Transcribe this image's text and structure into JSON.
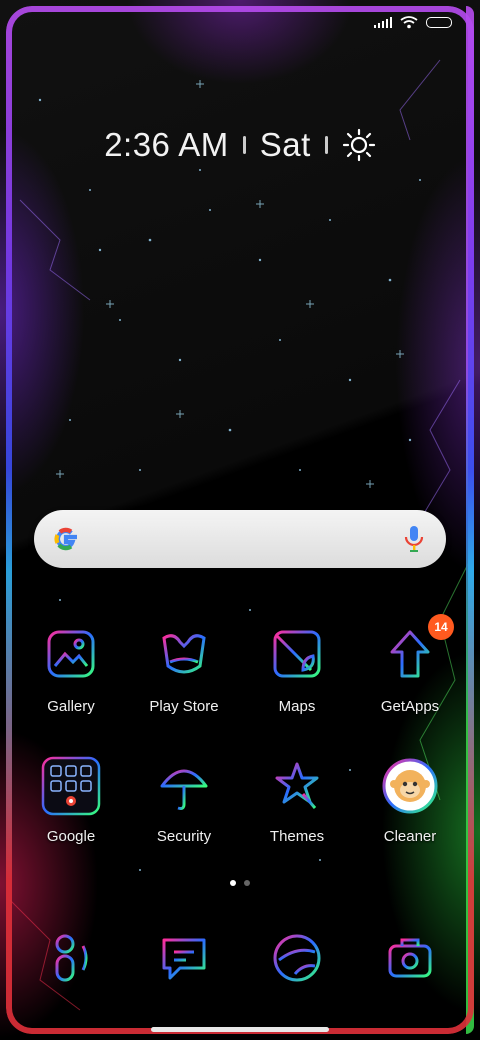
{
  "status_bar": {
    "signal_icon": "signal-icon",
    "wifi_icon": "wifi-icon",
    "battery_icon": "battery-icon"
  },
  "clock_widget": {
    "time": "2:36 AM",
    "day": "Sat",
    "weather_icon": "sun-icon"
  },
  "search_bar": {
    "logo": "google-g-logo",
    "mic_icon": "microphone-icon"
  },
  "apps_row1": [
    {
      "label": "Gallery",
      "icon": "gallery-icon"
    },
    {
      "label": "Play Store",
      "icon": "play-store-icon"
    },
    {
      "label": "Maps",
      "icon": "maps-icon"
    },
    {
      "label": "GetApps",
      "icon": "getapps-icon",
      "badge": "14"
    }
  ],
  "apps_row2": [
    {
      "label": "Google",
      "icon": "google-folder-icon"
    },
    {
      "label": "Security",
      "icon": "security-icon"
    },
    {
      "label": "Themes",
      "icon": "themes-icon"
    },
    {
      "label": "Cleaner",
      "icon": "cleaner-icon"
    }
  ],
  "page_indicator": {
    "pages": 2,
    "current": 1
  },
  "dock": [
    {
      "icon": "phone-icon"
    },
    {
      "icon": "messages-icon"
    },
    {
      "icon": "browser-icon"
    },
    {
      "icon": "camera-icon"
    }
  ],
  "colors": {
    "badge": "#ff5a1f",
    "neon_start": "#ff2d9a",
    "neon_mid": "#2b6cff",
    "neon_end": "#37ff7a"
  }
}
